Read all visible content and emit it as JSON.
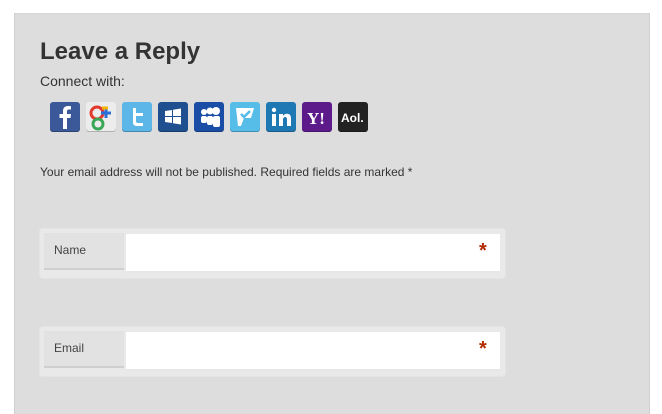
{
  "heading": "Leave a Reply",
  "connect_label": "Connect with:",
  "social": [
    {
      "name": "facebook-icon",
      "glyph": "f",
      "color": "#3b5998"
    },
    {
      "name": "google-icon",
      "glyph": "g",
      "color": "#e8e8e8"
    },
    {
      "name": "twitter-icon",
      "glyph": "t",
      "color": "#5cb6e8"
    },
    {
      "name": "windows-live-icon",
      "glyph": "win",
      "color": "#1f4f8f"
    },
    {
      "name": "myspace-icon",
      "glyph": "ms",
      "color": "#1a4ea6"
    },
    {
      "name": "foursquare-icon",
      "glyph": "4sq",
      "color": "#56bde8"
    },
    {
      "name": "linkedin-icon",
      "glyph": "in",
      "color": "#1e78b4"
    },
    {
      "name": "yahoo-icon",
      "glyph": "Y!",
      "color": "#5c1a8a"
    },
    {
      "name": "aol-icon",
      "glyph": "Aol.",
      "color": "#222222"
    }
  ],
  "notice": "Your email address will not be published. Required fields are marked *",
  "fields": [
    {
      "label": "Name",
      "value": "",
      "required_mark": "*"
    },
    {
      "label": "Email",
      "value": "",
      "required_mark": "*"
    }
  ]
}
